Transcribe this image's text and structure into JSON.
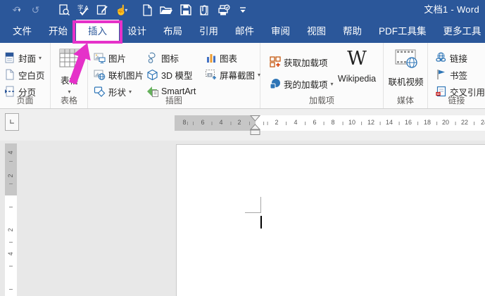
{
  "window": {
    "title": "文档1 - Word"
  },
  "qat": {
    "icons": [
      "undo",
      "redo",
      "print-preview",
      "spelling-grammar",
      "edit-document",
      "touch-mouse-mode",
      "new-document",
      "open",
      "save",
      "attach-file",
      "quick-print",
      "customize-quick-access-toolbar"
    ]
  },
  "tabs": {
    "active": "插入",
    "items": [
      {
        "label": "文件"
      },
      {
        "label": "开始"
      },
      {
        "label": "插入"
      },
      {
        "label": "设计"
      },
      {
        "label": "布局"
      },
      {
        "label": "引用"
      },
      {
        "label": "邮件"
      },
      {
        "label": "审阅"
      },
      {
        "label": "视图"
      },
      {
        "label": "帮助"
      },
      {
        "label": "PDF工具集"
      },
      {
        "label": "更多工具"
      }
    ]
  },
  "ribbon": {
    "groups": [
      {
        "label": "页面",
        "items": [
          {
            "label": "封面",
            "dropdown": true
          },
          {
            "label": "空白页"
          },
          {
            "label": "分页"
          }
        ]
      },
      {
        "label": "表格",
        "items": [
          {
            "label": "表格",
            "dropdown": true
          }
        ]
      },
      {
        "label": "插图",
        "items": [
          {
            "label": "图片"
          },
          {
            "label": "联机图片"
          },
          {
            "label": "形状",
            "dropdown": true
          },
          {
            "label": "图标"
          },
          {
            "label": "3D 模型"
          },
          {
            "label": "SmartArt"
          },
          {
            "label": "图表"
          },
          {
            "label": "屏幕截图",
            "dropdown": true
          }
        ]
      },
      {
        "label": "加载项",
        "items": [
          {
            "label": "获取加载项"
          },
          {
            "label": "我的加载项",
            "dropdown": true
          },
          {
            "label": "Wikipedia"
          }
        ]
      },
      {
        "label": "媒体",
        "items": [
          {
            "label": "联机视频"
          }
        ]
      },
      {
        "label": "链接",
        "items": [
          {
            "label": "链接"
          },
          {
            "label": "书签"
          },
          {
            "label": "交叉引用"
          }
        ]
      }
    ]
  },
  "ruler_horizontal": {
    "margin_numbers": [
      "8",
      "6",
      "4",
      "2"
    ],
    "numbers": [
      "2",
      "4",
      "6",
      "8",
      "10",
      "12",
      "14",
      "16",
      "18",
      "20",
      "22",
      "24"
    ]
  },
  "ruler_vertical": {
    "margin_numbers": [
      "4",
      "2"
    ],
    "numbers": [
      "2",
      "4"
    ]
  },
  "annotation": {
    "type": "highlight-box-with-arrow",
    "target_tab": "插入",
    "color": "#e531c9"
  },
  "colors": {
    "titlebar": "#2b579a",
    "accent": "#2b579a",
    "annotation": "#e531c9"
  }
}
